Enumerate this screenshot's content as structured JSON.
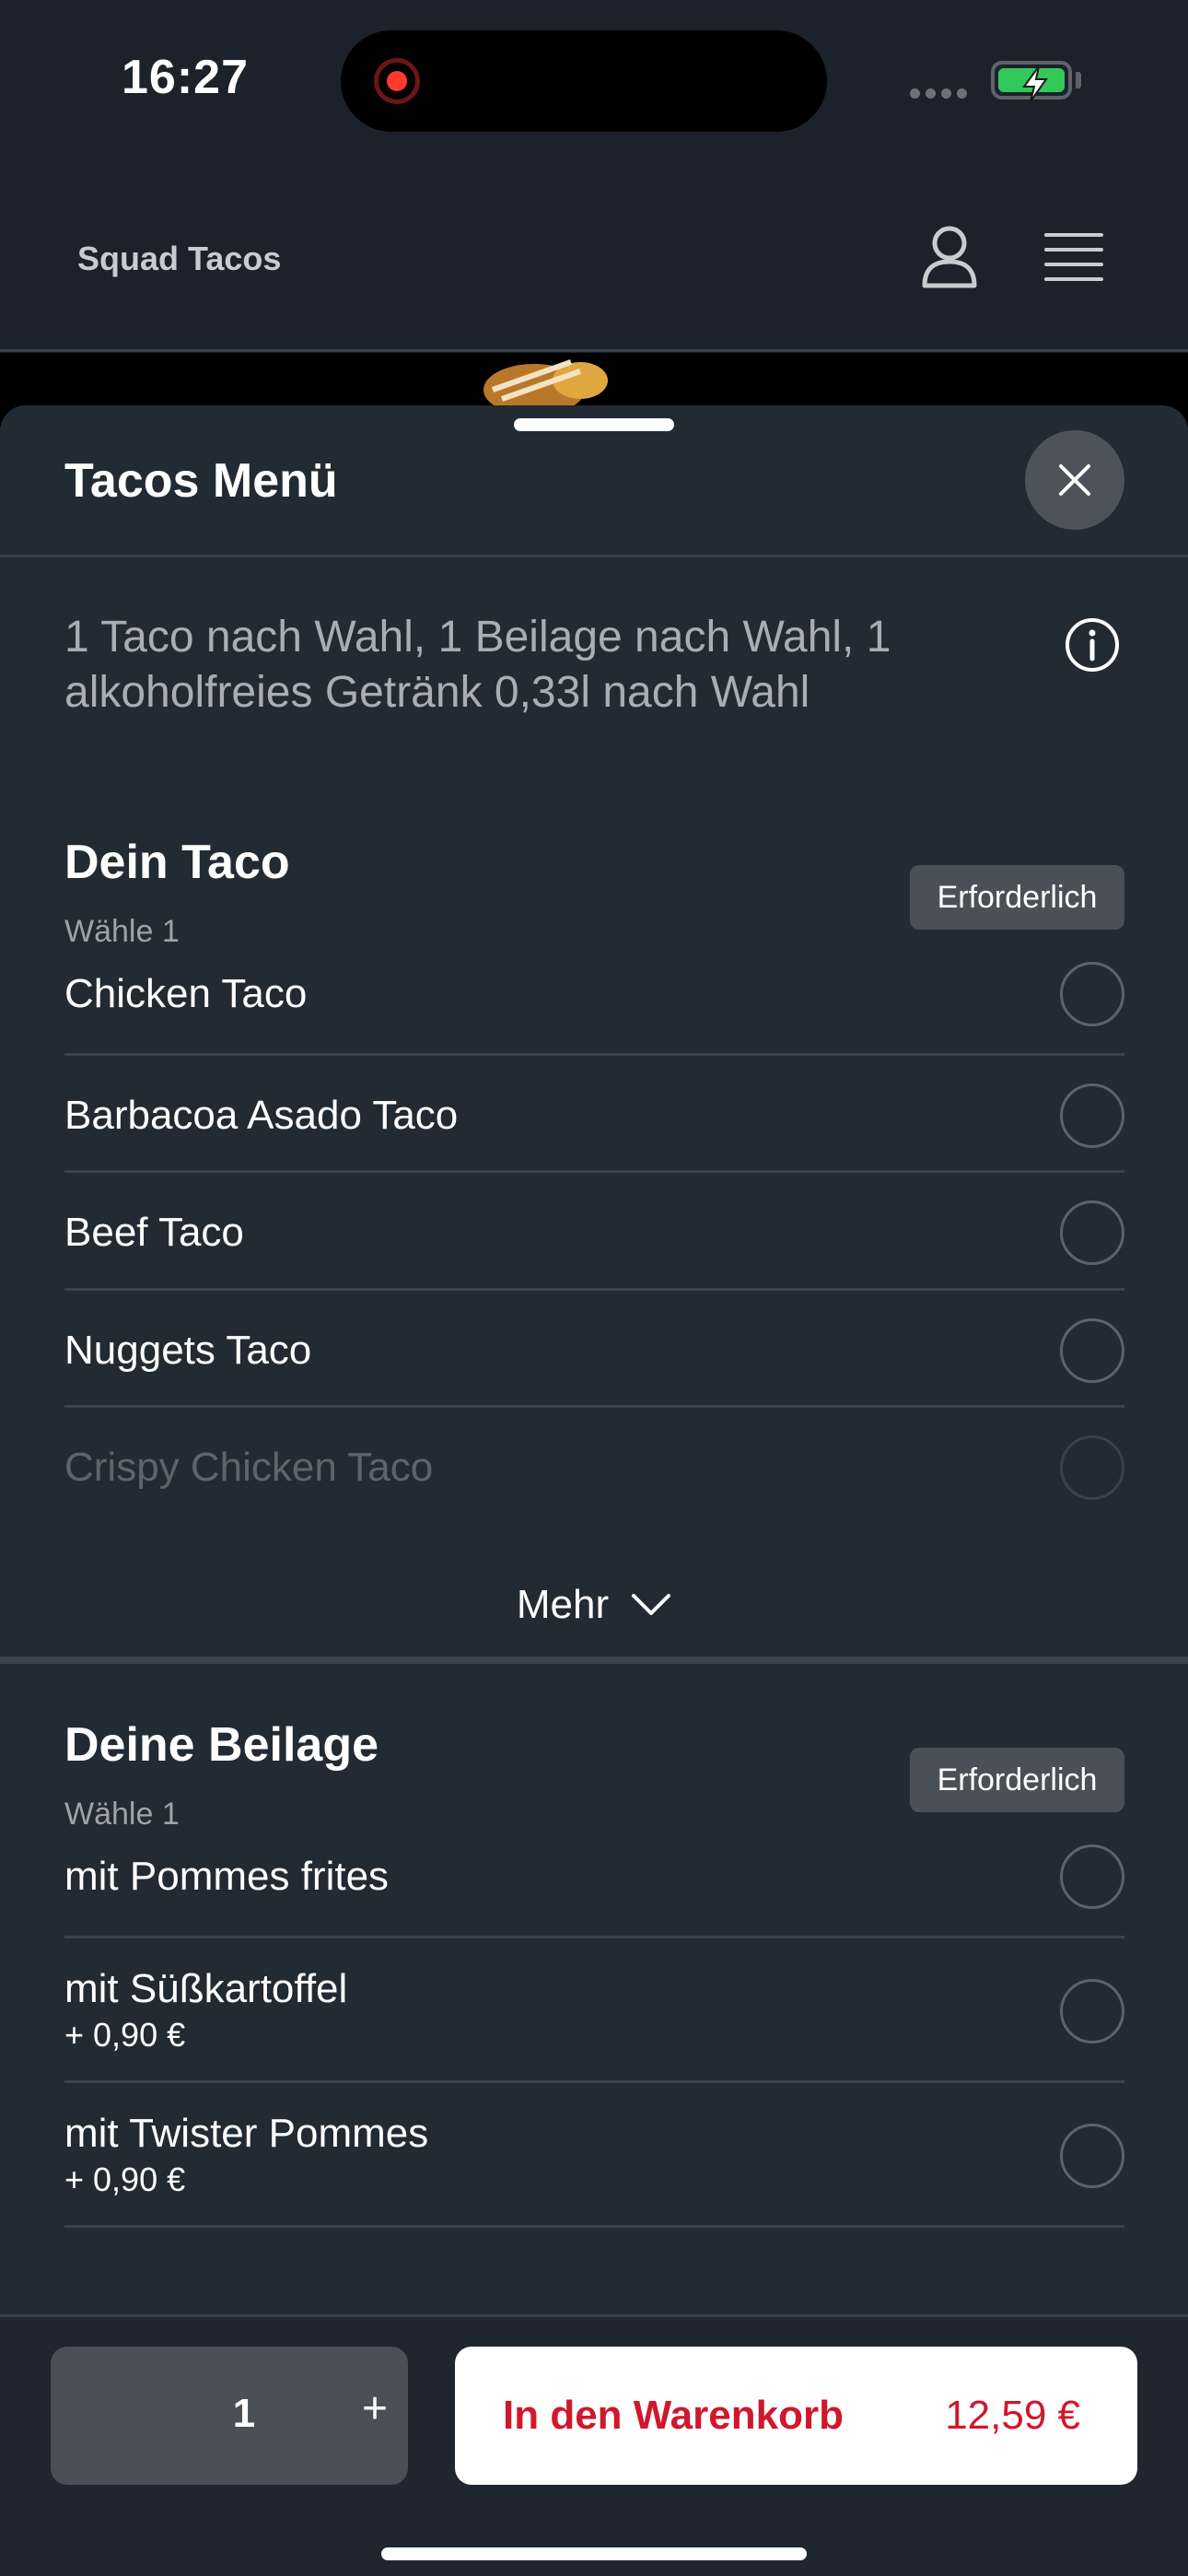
{
  "status_bar": {
    "time": "16:27"
  },
  "header": {
    "brand": "Squad Tacos"
  },
  "sheet": {
    "title": "Tacos Menü",
    "description": "1 Taco nach Wahl, 1 Beilage nach Wahl, 1 alkoholfreies Getränk 0,33l nach Wahl"
  },
  "sections": [
    {
      "title": "Dein Taco",
      "subtitle": "Wähle 1",
      "badge": "Erforderlich",
      "options": [
        {
          "label": "Chicken Taco"
        },
        {
          "label": "Barbacoa Asado Taco"
        },
        {
          "label": "Beef Taco"
        },
        {
          "label": "Nuggets Taco"
        },
        {
          "label": "Crispy Chicken Taco"
        }
      ],
      "more_label": "Mehr"
    },
    {
      "title": "Deine Beilage",
      "subtitle": "Wähle 1",
      "badge": "Erforderlich",
      "options": [
        {
          "label": "mit Pommes frites"
        },
        {
          "label": "mit Süßkartoffel",
          "price": "+ 0,90 €"
        },
        {
          "label": "mit Twister Pommes",
          "price": "+ 0,90 €"
        }
      ]
    }
  ],
  "footer": {
    "quantity": "1",
    "plus": "+",
    "cart_label": "In den Warenkorb",
    "cart_price": "12,59 €"
  },
  "colors": {
    "background": "#1b222b",
    "sheet": "#222a33",
    "accent_red": "#d0172b",
    "battery_green": "#34c759"
  }
}
